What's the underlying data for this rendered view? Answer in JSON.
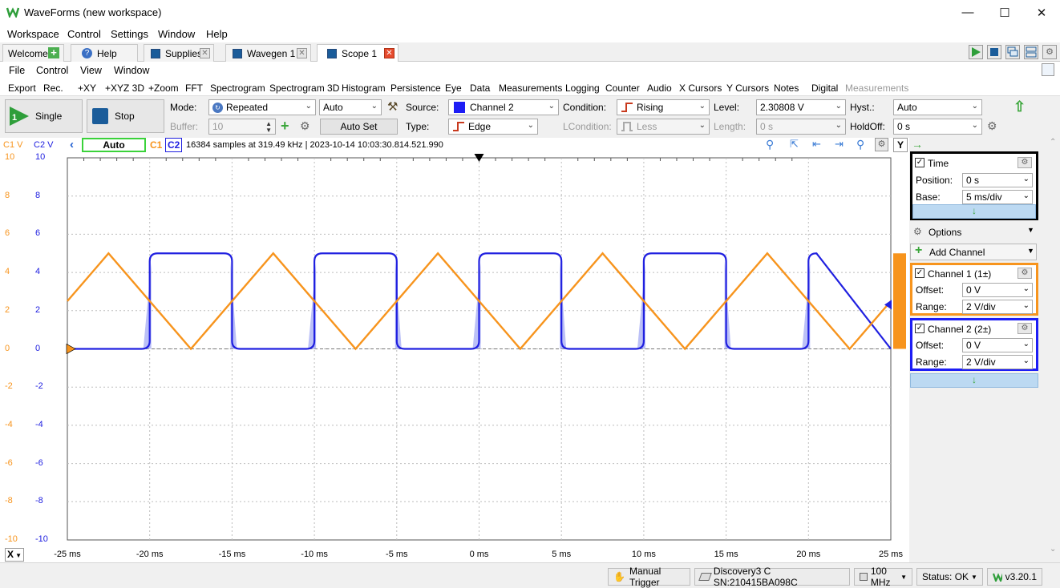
{
  "window": {
    "title": "WaveForms (new workspace)"
  },
  "menu": [
    "Workspace",
    "Control",
    "Settings",
    "Window",
    "Help"
  ],
  "tabs": [
    {
      "label": "Welcome"
    },
    {
      "label": "Help"
    },
    {
      "label": "Supplies"
    },
    {
      "label": "Wavegen 1"
    },
    {
      "label": "Scope 1"
    }
  ],
  "instrument_menu": [
    "File",
    "Control",
    "View",
    "Window"
  ],
  "toolbar2": [
    "Export",
    "Rec.",
    "+XY",
    "+XYZ 3D",
    "+Zoom",
    "FFT",
    "Spectrogram",
    "Spectrogram 3D",
    "Histogram",
    "Persistence",
    "Eye",
    "Data",
    "Measurements",
    "Logging",
    "Counter",
    "Audio",
    "X Cursors",
    "Y Cursors",
    "Notes",
    "Digital",
    "Measurements"
  ],
  "controls": {
    "single": "Single",
    "stop": "Stop",
    "mode_label": "Mode:",
    "mode_value": "Repeated",
    "auto_value": "Auto",
    "buffer_label": "Buffer:",
    "buffer_value": "10",
    "autoset": "Auto Set",
    "source_label": "Source:",
    "source_value": "Channel 2",
    "type_label": "Type:",
    "type_value": "Edge",
    "condition_label": "Condition:",
    "condition_value": "Rising",
    "lcondition_label": "LCondition:",
    "lcondition_value": "Less",
    "level_label": "Level:",
    "level_value": "2.30808 V",
    "length_label": "Length:",
    "length_value": "0 s",
    "hyst_label": "Hyst.:",
    "hyst_value": "Auto",
    "holdoff_label": "HoldOff:",
    "holdoff_value": "0 s"
  },
  "plot": {
    "c1_label": "C1 V",
    "c2_label": "C2 V",
    "auto_badge": "Auto",
    "c1_tag": "C1",
    "c2_tag": "C2",
    "info": "16384 samples at 319.49 kHz | 2023-10-14 10:03:30.814.521.990",
    "y_ticks": [
      "10",
      "8",
      "6",
      "4",
      "2",
      "0",
      "-2",
      "-4",
      "-6",
      "-8",
      "-10"
    ],
    "x_ticks": [
      "-25 ms",
      "-20 ms",
      "-15 ms",
      "-10 ms",
      "-5 ms",
      "0 ms",
      "5 ms",
      "10 ms",
      "15 ms",
      "20 ms",
      "25 ms"
    ],
    "x_axis_label": "X",
    "y_axis_btn": "Y",
    "c1_color": "#f7941d",
    "c2_color": "#2020e0"
  },
  "chart_data": {
    "type": "line",
    "x_unit": "ms",
    "xlim": [
      -25,
      25
    ],
    "ylim": [
      -10,
      10
    ],
    "grid": true,
    "series": [
      {
        "name": "C1",
        "shape": "triangle",
        "period_ms": 10,
        "min": 0,
        "max": 5,
        "peaks_x": [
          -22.5,
          -12.5,
          -2.5,
          7.5,
          17.5
        ],
        "troughs_x": [
          -17.5,
          -7.5,
          2.5,
          12.5,
          22.5
        ],
        "color": "#f7941d"
      },
      {
        "name": "C2",
        "shape": "square",
        "period_ms": 10,
        "low": 0,
        "high": 5,
        "rising_x": [
          -20,
          -10,
          0,
          10,
          20
        ],
        "falling_x": [
          -15,
          -5,
          5,
          15
        ],
        "color": "#2020e0"
      }
    ]
  },
  "right_panel": {
    "time_title": "Time",
    "position_label": "Position:",
    "position_value": "0 s",
    "base_label": "Base:",
    "base_value": "5 ms/div",
    "options": "Options",
    "add_channel": "Add Channel",
    "ch1_title": "Channel 1 (1±)",
    "ch1_offset_label": "Offset:",
    "ch1_offset_value": "0 V",
    "ch1_range_label": "Range:",
    "ch1_range_value": "2 V/div",
    "ch2_title": "Channel 2 (2±)",
    "ch2_offset_label": "Offset:",
    "ch2_offset_value": "0 V",
    "ch2_range_label": "Range:",
    "ch2_range_value": "2 V/div"
  },
  "status": {
    "manual_trigger": "Manual Trigger",
    "device": "Discovery3 C SN:210415BA098C",
    "freq": "100 MHz",
    "status": "Status: OK",
    "version": "v3.20.1"
  }
}
